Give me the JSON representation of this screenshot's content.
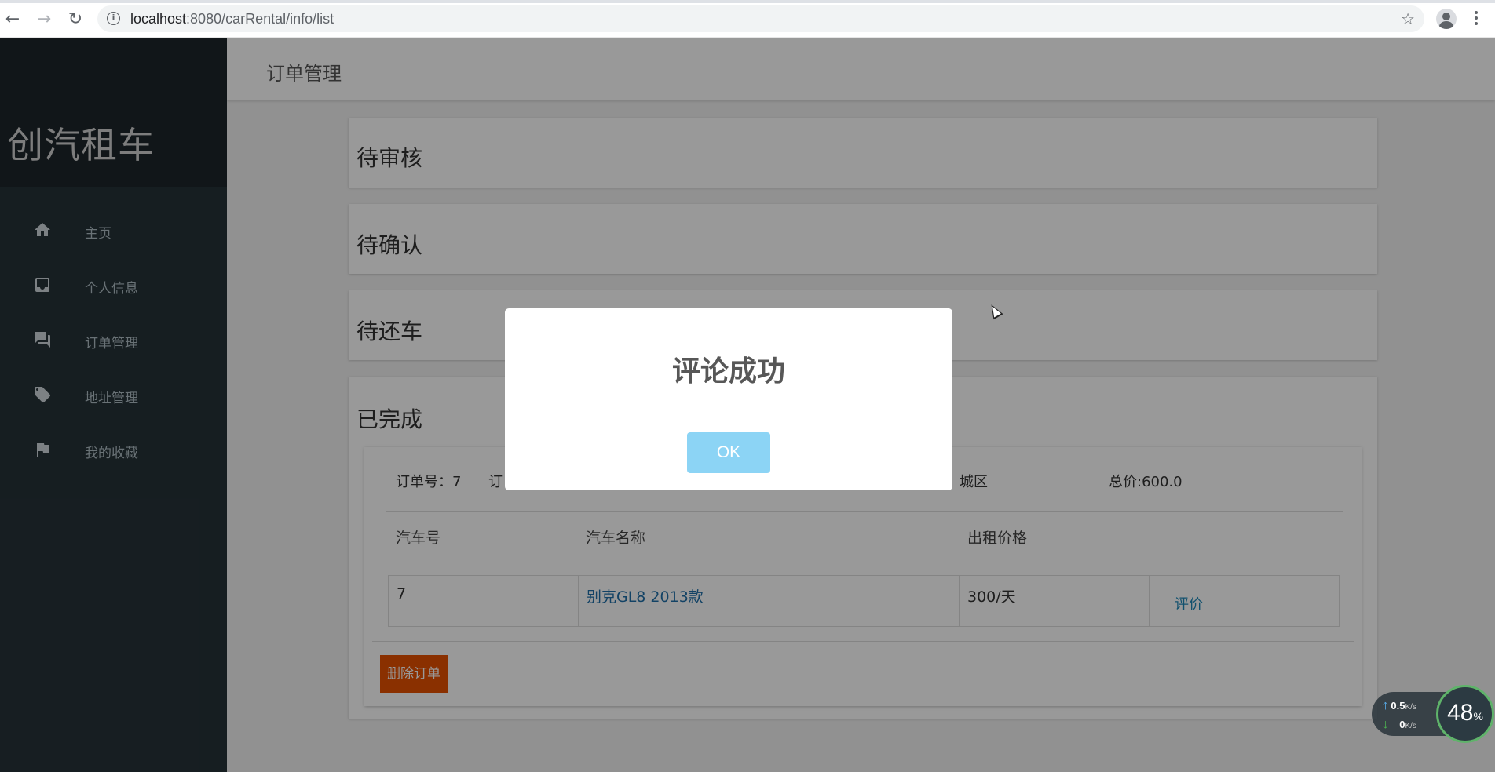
{
  "browser": {
    "url_host": "localhost",
    "url_path": ":8080/carRental/info/list"
  },
  "brand": "创汽租车",
  "sidebar": {
    "items": [
      {
        "label": "主页",
        "icon": "home-icon"
      },
      {
        "label": "个人信息",
        "icon": "inbox-icon"
      },
      {
        "label": "订单管理",
        "icon": "chat-icon"
      },
      {
        "label": "地址管理",
        "icon": "tag-icon"
      },
      {
        "label": "我的收藏",
        "icon": "flag-icon"
      }
    ]
  },
  "header": {
    "title": "订单管理"
  },
  "sections": {
    "pending_review": "待审核",
    "pending_confirm": "待确认",
    "pending_return": "待还车",
    "completed": "已完成"
  },
  "order": {
    "order_no": "订单号：7",
    "order_prefix": "订",
    "address_fragment": "城区",
    "total": "总价:600.0",
    "columns": [
      "汽车号",
      "汽车名称",
      "出租价格"
    ],
    "row": {
      "car_no": "7",
      "car_name": "别克GL8 2013款",
      "price": "300/天",
      "action": "评价"
    },
    "delete_label": "删除订单"
  },
  "dialog": {
    "title": "评论成功",
    "ok_label": "OK"
  },
  "net_widget": {
    "upload": "0.5",
    "download": "0",
    "unit": "K/s",
    "percent": "48",
    "percent_sign": "%"
  },
  "colors": {
    "sidebar": "#263238",
    "delete_button": "#e65100",
    "ok_button": "#8cd4f5"
  }
}
